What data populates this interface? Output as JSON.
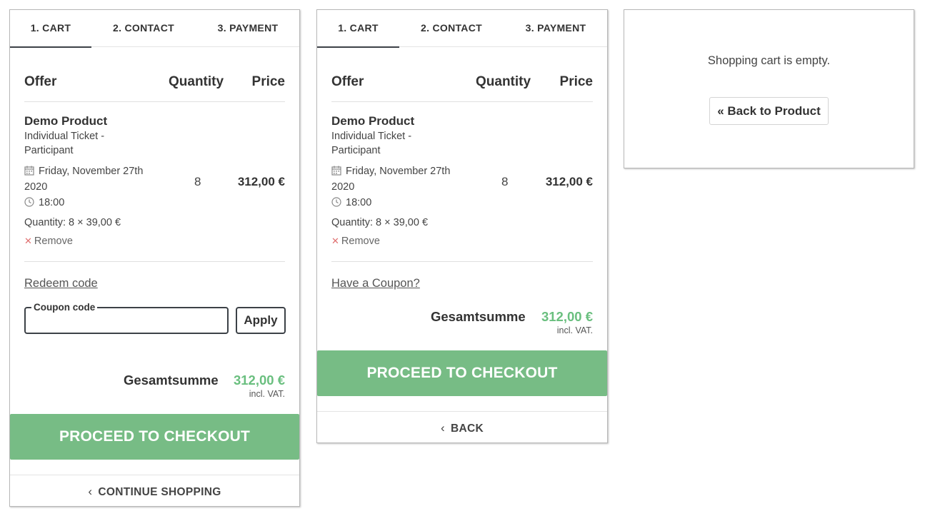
{
  "tabs": [
    "1. CART",
    "2. CONTACT",
    "3. PAYMENT"
  ],
  "table": {
    "offer_header": "Offer",
    "quantity_header": "Quantity",
    "price_header": "Price"
  },
  "item": {
    "name": "Demo Product",
    "description": "Individual Ticket - Participant",
    "date": "Friday, November 27th 2020",
    "time": "18:00",
    "quantity_detail": "Quantity: 8 × 39,00 €",
    "remove_label": "Remove",
    "quantity": "8",
    "price": "312,00 €"
  },
  "panel1": {
    "redeem_link": "Redeem code",
    "coupon_label": "Coupon code",
    "apply_label": "Apply",
    "total_label": "Gesamtsumme",
    "total_value": "312,00 €",
    "vat_note": "incl. VAT.",
    "checkout_label": "PROCEED TO CHECKOUT",
    "continue_label": "CONTINUE SHOPPING"
  },
  "panel2": {
    "coupon_link": "Have a Coupon?",
    "total_label": "Gesamtsumme",
    "total_value": "312,00 €",
    "vat_note": "incl. VAT.",
    "checkout_label": "PROCEED TO CHECKOUT",
    "back_label": "BACK"
  },
  "panel3": {
    "empty_message": "Shopping cart is empty.",
    "back_product_label": "« Back to Product"
  },
  "colors": {
    "accent_green": "#77bc85",
    "total_green": "#6abf7f",
    "dark_border": "#3c4147",
    "remove_red": "#e07070"
  }
}
